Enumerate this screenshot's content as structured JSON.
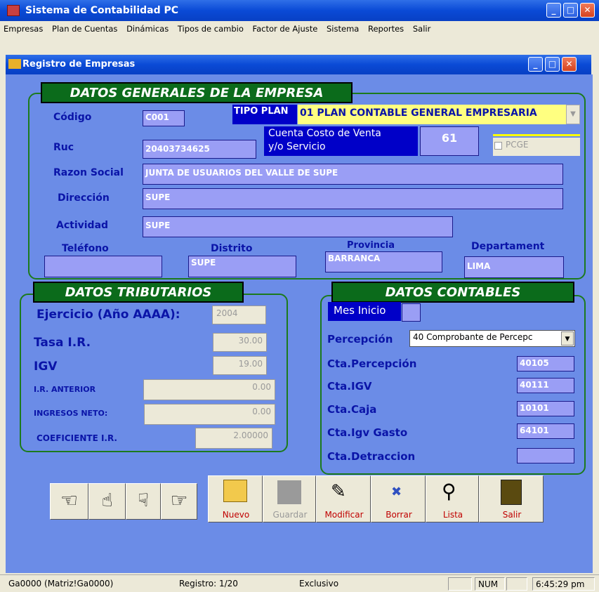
{
  "app": {
    "title": "Sistema de Contabilidad PC"
  },
  "menu": [
    "Empresas",
    "Plan de Cuentas",
    "Dinámicas",
    "Tipos de cambio",
    "Factor de Ajuste",
    "Sistema",
    "Reportes",
    "Salir"
  ],
  "window": {
    "title": "Registro de Empresas"
  },
  "general": {
    "title": "DATOS GENERALES DE LA EMPRESA",
    "codigo_label": "Código",
    "codigo": "C001",
    "tipo_plan_label": "TIPO PLAN",
    "tipo_plan": "01 PLAN CONTABLE GENERAL EMPRESARIA",
    "cuenta_costo_label_1": "Cuenta Costo de Venta",
    "cuenta_costo_label_2": "y/o Servicio",
    "cuenta_costo": "61",
    "pcge_label": "PCGE",
    "ruc_label": "Ruc",
    "ruc": "20403734625",
    "razon_label": "Razon Social",
    "razon": "JUNTA DE USUARIOS DEL VALLE DE  SUPE",
    "direccion_label": "Dirección",
    "direccion": "SUPE",
    "actividad_label": "Actividad",
    "actividad": "SUPE",
    "telefono_label": "Teléfono",
    "telefono": "",
    "distrito_label": "Distrito",
    "distrito": "SUPE",
    "provincia_label": "Provincia",
    "provincia": "BARRANCA",
    "departamento_label": "Departament",
    "departamento": "LIMA"
  },
  "tributarios": {
    "title": "DATOS TRIBUTARIOS",
    "ejercicio_label": "Ejercicio (Año AAAA):",
    "ejercicio": "2004",
    "tasa_label": "Tasa I.R.",
    "tasa": "30.00",
    "igv_label": "IGV",
    "igv": "19.00",
    "ir_anterior_label": "I.R. ANTERIOR",
    "ir_anterior": "0.00",
    "ingresos_label": "INGRESOS NETO:",
    "ingresos": "0.00",
    "coef_label": "COEFICIENTE I.R.",
    "coef": "2.00000"
  },
  "contables": {
    "title": "DATOS CONTABLES",
    "mes_label": "Mes Inicio",
    "mes": "",
    "percepcion_label": "Percepción",
    "percepcion": "40 Comprobante de Percepc",
    "cta_percepcion_label": "Cta.Percepción",
    "cta_percepcion": "40105",
    "cta_igv_label": "Cta.IGV",
    "cta_igv": "40111",
    "cta_caja_label": "Cta.Caja",
    "cta_caja": "10101",
    "cta_igv_gasto_label": "Cta.Igv Gasto",
    "cta_igv_gasto": "64101",
    "cta_detraccion_label": "Cta.Detraccion",
    "cta_detraccion": ""
  },
  "toolbar": {
    "nuevo": "Nuevo",
    "guardar": "Guardar",
    "modificar": "Modificar",
    "borrar": "Borrar",
    "lista": "Lista",
    "salir": "Salir"
  },
  "status": {
    "p1": "Ga0000 (Matriz!Ga0000)",
    "p2": "Registro: 1/20",
    "p3": "Exclusivo",
    "p4": "",
    "p5": "NUM",
    "p6": "",
    "p7": "6:45:29 pm"
  }
}
